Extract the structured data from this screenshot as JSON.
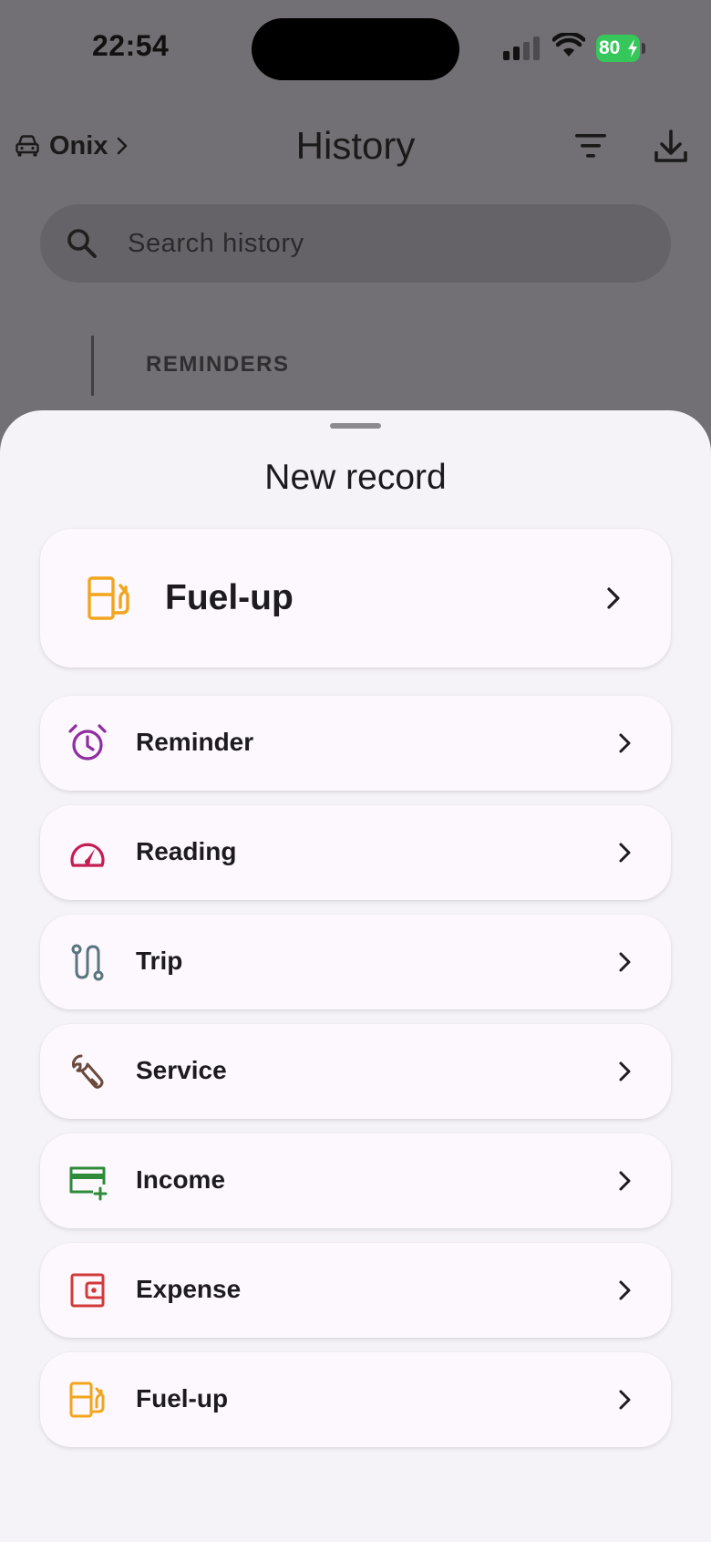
{
  "status_bar": {
    "time": "22:54",
    "battery_percent": "80"
  },
  "header": {
    "vehicle_name": "Onix",
    "title": "History"
  },
  "search": {
    "placeholder": "Search history"
  },
  "background_section": {
    "label": "REMINDERS"
  },
  "sheet": {
    "title": "New record",
    "featured": {
      "label": "Fuel-up",
      "icon": "fuel-pump-icon",
      "color": "#f2a51c"
    },
    "items": [
      {
        "label": "Reminder",
        "icon": "alarm-clock-icon",
        "color": "#8e2ca0"
      },
      {
        "label": "Reading",
        "icon": "speedometer-icon",
        "color": "#c41d52"
      },
      {
        "label": "Trip",
        "icon": "route-icon",
        "color": "#5a7480"
      },
      {
        "label": "Service",
        "icon": "wrench-icon",
        "color": "#6b4a3e"
      },
      {
        "label": "Income",
        "icon": "card-plus-icon",
        "color": "#2e8b3a"
      },
      {
        "label": "Expense",
        "icon": "wallet-icon",
        "color": "#d33a3a"
      },
      {
        "label": "Fuel-up",
        "icon": "fuel-pump-icon",
        "color": "#f2a51c"
      }
    ]
  }
}
